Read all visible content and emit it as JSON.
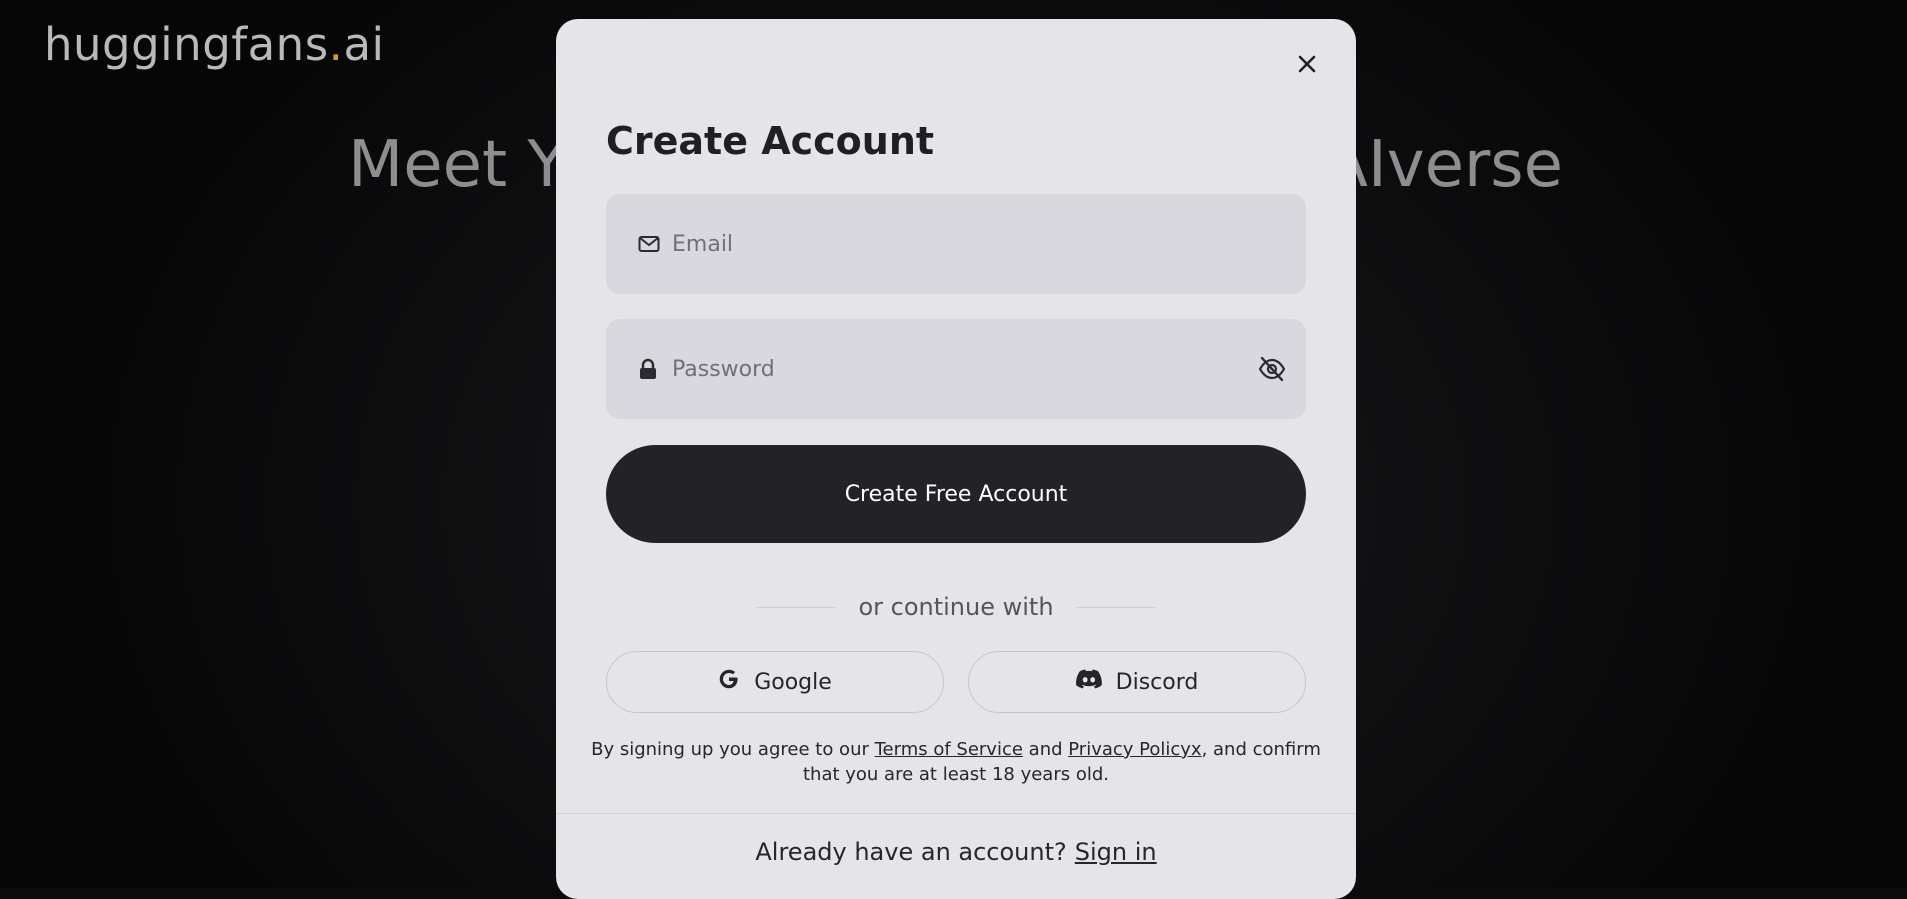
{
  "brand": {
    "name_main": "huggingfans",
    "name_dot": ".",
    "name_tld": "ai"
  },
  "hero": {
    "left_text": "Meet Yo",
    "right_text": "AIverse"
  },
  "modal": {
    "title": "Create Account",
    "email": {
      "placeholder": "Email",
      "icon": "mail-icon"
    },
    "password": {
      "placeholder": "Password",
      "icon": "lock-icon",
      "toggle_icon": "eye-off-icon"
    },
    "submit_label": "Create Free Account",
    "divider_text": "or continue with",
    "social": [
      {
        "label": "Google",
        "icon": "google-icon"
      },
      {
        "label": "Discord",
        "icon": "discord-icon"
      }
    ],
    "legal": {
      "prefix": "By signing up you agree to our ",
      "terms": "Terms of Service",
      "and": " and ",
      "privacy": "Privacy Policyx",
      "suffix": ", and confirm that you are at least 18 years old."
    },
    "footer": {
      "question": "Already have an account?",
      "signin": "Sign in"
    }
  },
  "colors": {
    "accent_dot": "#d6963a",
    "modal_bg": "#e4e4e9",
    "cta_bg": "#222227"
  }
}
